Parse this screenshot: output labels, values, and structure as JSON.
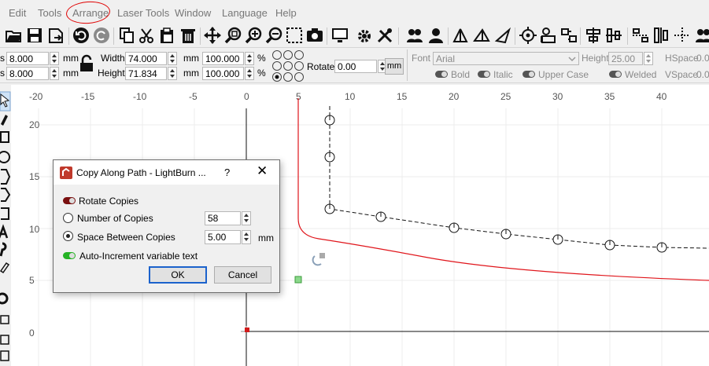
{
  "menu": [
    "Edit",
    "Tools",
    "Arrange",
    "Laser Tools",
    "Window",
    "Language",
    "Help"
  ],
  "annotation_color": "#e00000",
  "toolbar_icons": [
    "open-folder-icon",
    "save-icon",
    "export-icon",
    "undo-icon",
    "redo-icon",
    "copy-icon",
    "cut-icon",
    "paste-icon",
    "delete-icon",
    "move-icon",
    "zoom-fit-icon",
    "zoom-in-icon",
    "zoom-out-icon",
    "frame-select-icon",
    "camera-icon",
    "monitor-icon",
    "settings-gear-icon",
    "tools-wrench-icon",
    "group-icon",
    "ungroup-icon",
    "flip-horizontal-icon",
    "flip-vertical-icon",
    "mirror-icon",
    "center-target-icon",
    "align-left-icon",
    "align-right-icon",
    "align-top-icon",
    "align-bottom-icon",
    "distribute-icon",
    "more-icon"
  ],
  "props": {
    "x_label": "s",
    "x_value": "8.000",
    "x_unit": "mm",
    "y_label": "s",
    "y_value": "8.000",
    "y_unit": "mm",
    "width_label": "Width",
    "width_value": "74.000",
    "width_unit": "mm",
    "height_label": "Height",
    "height_value": "71.834",
    "height_unit": "mm",
    "scale_w": "100.000",
    "scale_h": "100.000",
    "pct": "%",
    "rotate_label": "Rotate",
    "rotate_value": "0.00",
    "mm_button": "mm",
    "font_label": "Font",
    "font_value": "Arial",
    "font_height_label": "Height",
    "font_height_value": "25.00",
    "hspace_label": "HSpace",
    "hspace_value": "0.0",
    "vspace_label": "VSpace",
    "vspace_value": "0.0",
    "bold": "Bold",
    "italic": "Italic",
    "upper": "Upper Case",
    "welded": "Welded"
  },
  "ruler": {
    "x_ticks": [
      "-20",
      "-15",
      "-10",
      "-5",
      "0",
      "5",
      "10",
      "15",
      "20",
      "25",
      "30",
      "35",
      "40"
    ],
    "y_ticks": [
      "20",
      "15",
      "10",
      "5",
      "0"
    ]
  },
  "dialog": {
    "title": "Copy Along Path - LightBurn ...",
    "help": "?",
    "rotate_copies": "Rotate Copies",
    "number_of_copies": "Number of Copies",
    "number_value": "58",
    "space_between": "Space Between Copies",
    "space_value": "5.00",
    "space_unit": "mm",
    "auto_increment": "Auto-Increment variable text",
    "ok": "OK",
    "cancel": "Cancel"
  },
  "colors": {
    "path_red": "#e0151b",
    "dialog_icon": "#c0392b",
    "toggle_green": "#25b325",
    "default_button_border": "#1b62cc"
  }
}
